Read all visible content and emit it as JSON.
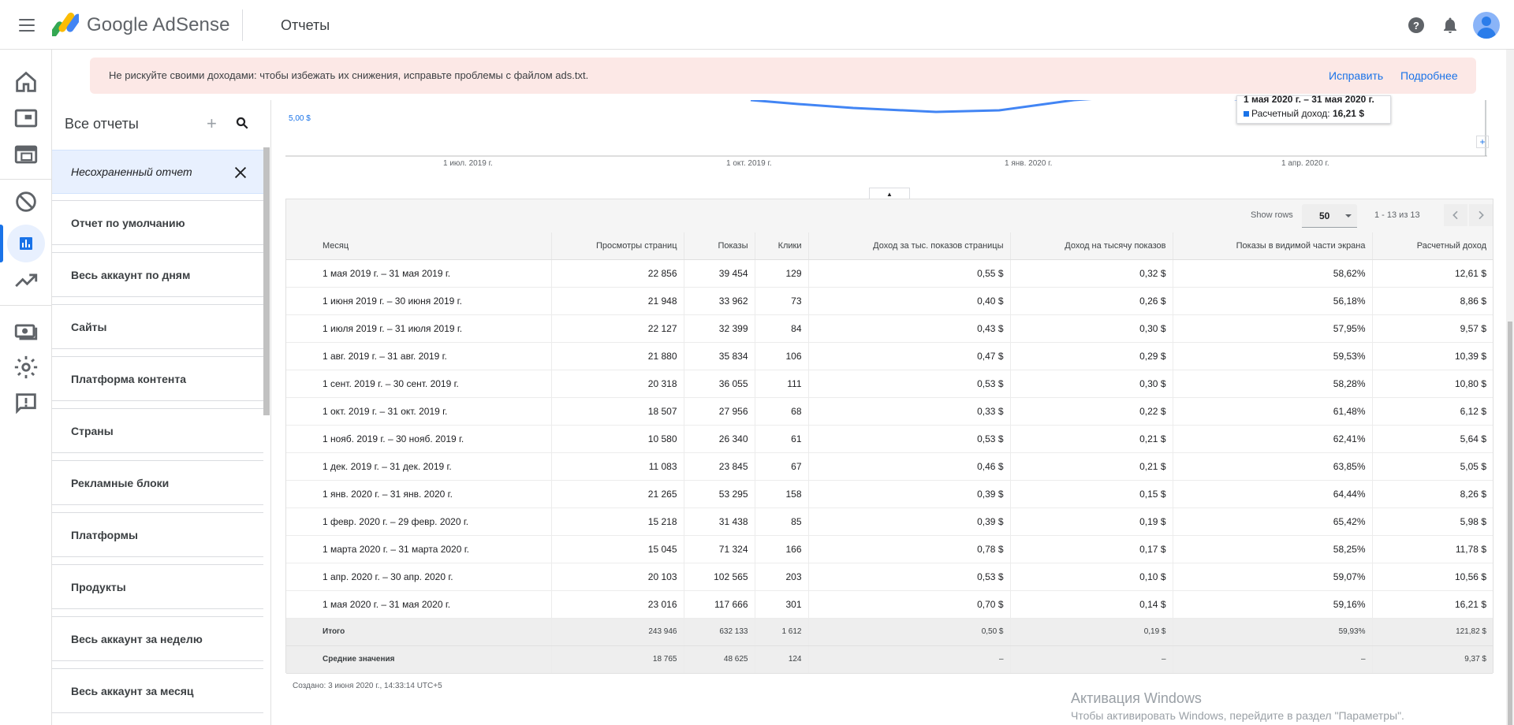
{
  "app": {
    "brand": "Google AdSense",
    "page_title": "Отчеты"
  },
  "alert": {
    "text": "Не рискуйте своими доходами: чтобы избежать их снижения, исправьте проблемы с файлом ads.txt.",
    "fix_link": "Исправить",
    "more_link": "Подробнее"
  },
  "panel": {
    "title": "Все отчеты",
    "unsaved": "Несохраненный отчет",
    "items": [
      "Отчет по умолчанию",
      "Весь аккаунт по дням",
      "Сайты",
      "Платформа контента",
      "Страны",
      "Рекламные блоки",
      "Платформы",
      "Продукты",
      "Весь аккаунт за неделю",
      "Весь аккаунт за месяц"
    ]
  },
  "chart": {
    "y_label": "5,00 $",
    "x_ticks": [
      "1 июл. 2019 г.",
      "1 окт. 2019 г.",
      "1 янв. 2020 г.",
      "1 апр. 2020 г."
    ],
    "tooltip_date": "1 мая 2020 г. – 31 мая 2020 г.",
    "tooltip_label": "Расчетный доход:",
    "tooltip_value": "16,21 $",
    "colors": {
      "series": "#1a73e8"
    }
  },
  "table_tools": {
    "show_rows_label": "Show rows",
    "show_rows_value": "50",
    "pager": "1 - 13 из 13"
  },
  "table": {
    "columns": [
      "Месяц",
      "Просмотры страниц",
      "Показы",
      "Клики",
      "Доход за тыс. показов страницы",
      "Доход на тысячу показов",
      "Показы в видимой части экрана",
      "Расчетный доход"
    ],
    "rows": [
      [
        "1 мая 2019 г. – 31 мая 2019 г.",
        "22 856",
        "39 454",
        "129",
        "0,55 $",
        "0,32 $",
        "58,62%",
        "12,61 $"
      ],
      [
        "1 июня 2019 г. – 30 июня 2019 г.",
        "21 948",
        "33 962",
        "73",
        "0,40 $",
        "0,26 $",
        "56,18%",
        "8,86 $"
      ],
      [
        "1 июля 2019 г. – 31 июля 2019 г.",
        "22 127",
        "32 399",
        "84",
        "0,43 $",
        "0,30 $",
        "57,95%",
        "9,57 $"
      ],
      [
        "1 авг. 2019 г. – 31 авг. 2019 г.",
        "21 880",
        "35 834",
        "106",
        "0,47 $",
        "0,29 $",
        "59,53%",
        "10,39 $"
      ],
      [
        "1 сент. 2019 г. – 30 сент. 2019 г.",
        "20 318",
        "36 055",
        "111",
        "0,53 $",
        "0,30 $",
        "58,28%",
        "10,80 $"
      ],
      [
        "1 окт. 2019 г. – 31 окт. 2019 г.",
        "18 507",
        "27 956",
        "68",
        "0,33 $",
        "0,22 $",
        "61,48%",
        "6,12 $"
      ],
      [
        "1 нояб. 2019 г. – 30 нояб. 2019 г.",
        "10 580",
        "26 340",
        "61",
        "0,53 $",
        "0,21 $",
        "62,41%",
        "5,64 $"
      ],
      [
        "1 дек. 2019 г. – 31 дек. 2019 г.",
        "11 083",
        "23 845",
        "67",
        "0,46 $",
        "0,21 $",
        "63,85%",
        "5,05 $"
      ],
      [
        "1 янв. 2020 г. – 31 янв. 2020 г.",
        "21 265",
        "53 295",
        "158",
        "0,39 $",
        "0,15 $",
        "64,44%",
        "8,26 $"
      ],
      [
        "1 февр. 2020 г. – 29 февр. 2020 г.",
        "15 218",
        "31 438",
        "85",
        "0,39 $",
        "0,19 $",
        "65,42%",
        "5,98 $"
      ],
      [
        "1 марта 2020 г. – 31 марта 2020 г.",
        "15 045",
        "71 324",
        "166",
        "0,78 $",
        "0,17 $",
        "58,25%",
        "11,78 $"
      ],
      [
        "1 апр. 2020 г. – 30 апр. 2020 г.",
        "20 103",
        "102 565",
        "203",
        "0,53 $",
        "0,10 $",
        "59,07%",
        "10,56 $"
      ],
      [
        "1 мая 2020 г. – 31 мая 2020 г.",
        "23 016",
        "117 666",
        "301",
        "0,70 $",
        "0,14 $",
        "59,16%",
        "16,21 $"
      ]
    ],
    "totals": [
      "Итого",
      "243 946",
      "632 133",
      "1 612",
      "0,50 $",
      "0,19 $",
      "59,93%",
      "121,82 $"
    ],
    "averages": [
      "Средние значения",
      "18 765",
      "48 625",
      "124",
      "–",
      "–",
      "–",
      "9,37 $"
    ]
  },
  "footer": {
    "created": "Создано: 3 июня 2020 г., 14:33:14 UTC+5"
  },
  "windows": {
    "title": "Активация Windows",
    "subtitle": "Чтобы активировать Windows, перейдите в раздел \"Параметры\"."
  },
  "icons": {
    "menu": "menu-icon",
    "help": "help-icon",
    "notifications": "bell-icon",
    "home": "home-icon",
    "sites": "browser-icon",
    "ads": "layout-icon",
    "block": "block-icon",
    "reports": "bar-chart-icon",
    "optimization": "trending-up-icon",
    "payments": "money-icon",
    "settings": "gear-icon",
    "feedback": "feedback-icon"
  }
}
